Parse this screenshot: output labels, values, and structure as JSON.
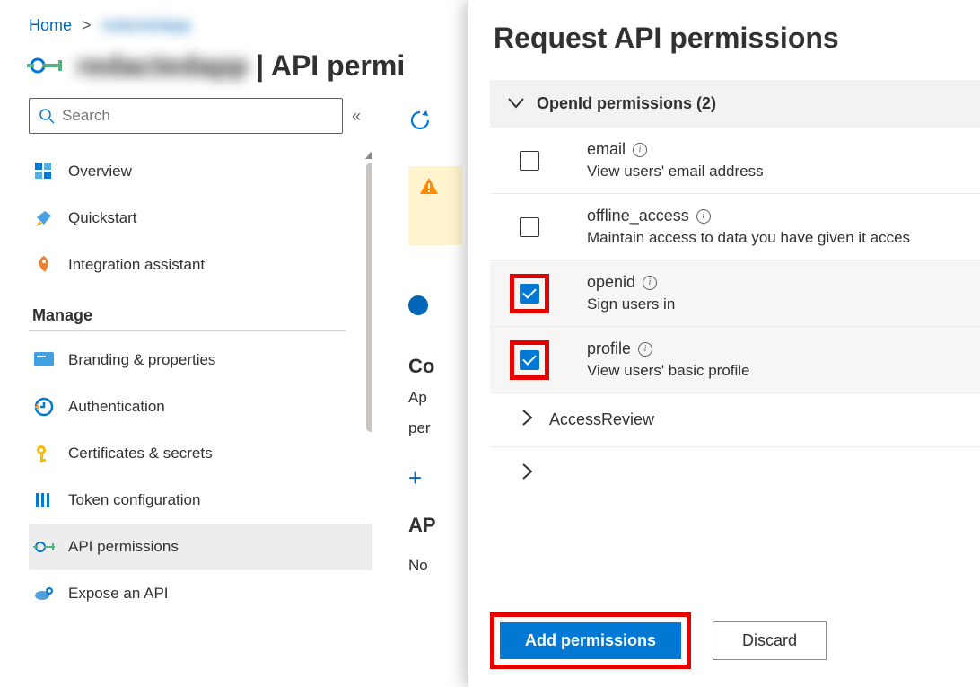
{
  "breadcrumb": {
    "home": "Home",
    "app": "redacted"
  },
  "title": {
    "app": "redacted",
    "suffix": " | API permi"
  },
  "search": {
    "placeholder": "Search"
  },
  "nav": {
    "overview": "Overview",
    "quickstart": "Quickstart",
    "integration": "Integration assistant",
    "manage_label": "Manage",
    "branding": "Branding & properties",
    "authentication": "Authentication",
    "certificates": "Certificates & secrets",
    "token": "Token configuration",
    "api_perm": "API permissions",
    "expose": "Expose an API"
  },
  "main": {
    "config_heading": "Co",
    "app_text": "Ap",
    "perm_text": "per",
    "ap_label": "AP",
    "no_label": "No"
  },
  "panel": {
    "title": "Request API permissions",
    "group_label": "OpenId permissions (2)",
    "permissions": [
      {
        "name": "email",
        "desc": "View users' email address",
        "checked": false,
        "highlight": false
      },
      {
        "name": "offline_access",
        "desc": "Maintain access to data you have given it acces",
        "checked": false,
        "highlight": false
      },
      {
        "name": "openid",
        "desc": "Sign users in",
        "checked": true,
        "highlight": true
      },
      {
        "name": "profile",
        "desc": "View users' basic profile",
        "checked": true,
        "highlight": true
      }
    ],
    "collapsed_group": "AccessReview",
    "add_btn": "Add permissions",
    "discard_btn": "Discard"
  }
}
